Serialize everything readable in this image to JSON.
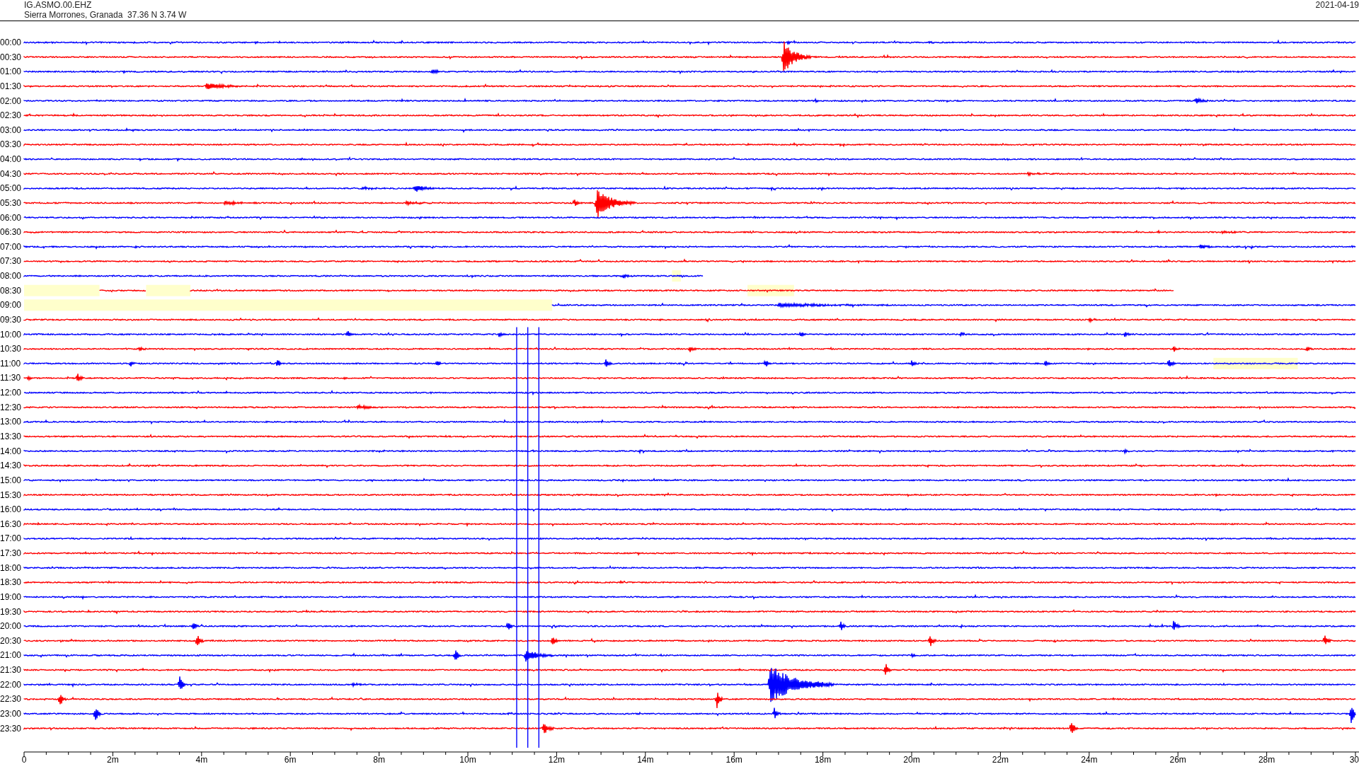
{
  "header": {
    "station": "IG.ASMO.00.EHZ",
    "location": "Sierra Morrones, Granada  37.36 N 3.74 W",
    "date": "2021-04-19"
  },
  "helicorder": {
    "rows": [
      {
        "label": "00:00",
        "color": "#0000ff"
      },
      {
        "label": "00:30",
        "color": "#ff0000"
      },
      {
        "label": "01:00",
        "color": "#0000ff"
      },
      {
        "label": "01:30",
        "color": "#ff0000"
      },
      {
        "label": "02:00",
        "color": "#0000ff"
      },
      {
        "label": "02:30",
        "color": "#ff0000"
      },
      {
        "label": "03:00",
        "color": "#0000ff"
      },
      {
        "label": "03:30",
        "color": "#ff0000"
      },
      {
        "label": "04:00",
        "color": "#0000ff"
      },
      {
        "label": "04:30",
        "color": "#ff0000"
      },
      {
        "label": "05:00",
        "color": "#0000ff"
      },
      {
        "label": "05:30",
        "color": "#ff0000"
      },
      {
        "label": "06:00",
        "color": "#0000ff"
      },
      {
        "label": "06:30",
        "color": "#ff0000"
      },
      {
        "label": "07:00",
        "color": "#0000ff"
      },
      {
        "label": "07:30",
        "color": "#ff0000"
      },
      {
        "label": "08:00",
        "color": "#0000ff"
      },
      {
        "label": "08:30",
        "color": "#ff0000"
      },
      {
        "label": "09:00",
        "color": "#0000ff"
      },
      {
        "label": "09:30",
        "color": "#ff0000"
      },
      {
        "label": "10:00",
        "color": "#0000ff"
      },
      {
        "label": "10:30",
        "color": "#ff0000"
      },
      {
        "label": "11:00",
        "color": "#0000ff"
      },
      {
        "label": "11:30",
        "color": "#ff0000"
      },
      {
        "label": "12:00",
        "color": "#0000ff"
      },
      {
        "label": "12:30",
        "color": "#ff0000"
      },
      {
        "label": "13:00",
        "color": "#0000ff"
      },
      {
        "label": "13:30",
        "color": "#ff0000"
      },
      {
        "label": "14:00",
        "color": "#0000ff"
      },
      {
        "label": "14:30",
        "color": "#ff0000"
      },
      {
        "label": "15:00",
        "color": "#0000ff"
      },
      {
        "label": "15:30",
        "color": "#ff0000"
      },
      {
        "label": "16:00",
        "color": "#0000ff"
      },
      {
        "label": "16:30",
        "color": "#ff0000"
      },
      {
        "label": "17:00",
        "color": "#0000ff"
      },
      {
        "label": "17:30",
        "color": "#ff0000"
      },
      {
        "label": "18:00",
        "color": "#0000ff"
      },
      {
        "label": "18:30",
        "color": "#ff0000"
      },
      {
        "label": "19:00",
        "color": "#0000ff"
      },
      {
        "label": "19:30",
        "color": "#ff0000"
      },
      {
        "label": "20:00",
        "color": "#0000ff"
      },
      {
        "label": "20:30",
        "color": "#ff0000"
      },
      {
        "label": "21:00",
        "color": "#0000ff"
      },
      {
        "label": "21:30",
        "color": "#ff0000"
      },
      {
        "label": "22:00",
        "color": "#0000ff"
      },
      {
        "label": "22:30",
        "color": "#ff0000"
      },
      {
        "label": "23:00",
        "color": "#0000ff"
      },
      {
        "label": "23:30",
        "color": "#ff0000"
      }
    ],
    "x_ticks": [
      {
        "label": "0"
      },
      {
        "label": "2m"
      },
      {
        "label": "4m"
      },
      {
        "label": "6m"
      },
      {
        "label": "8m"
      },
      {
        "label": "10m"
      },
      {
        "label": "12m"
      },
      {
        "label": "14m"
      },
      {
        "label": "16m"
      },
      {
        "label": "18m"
      },
      {
        "label": "20m"
      },
      {
        "label": "22m"
      },
      {
        "label": "24m"
      },
      {
        "label": "26m"
      },
      {
        "label": "28m"
      },
      {
        "label": "30"
      }
    ]
  }
}
